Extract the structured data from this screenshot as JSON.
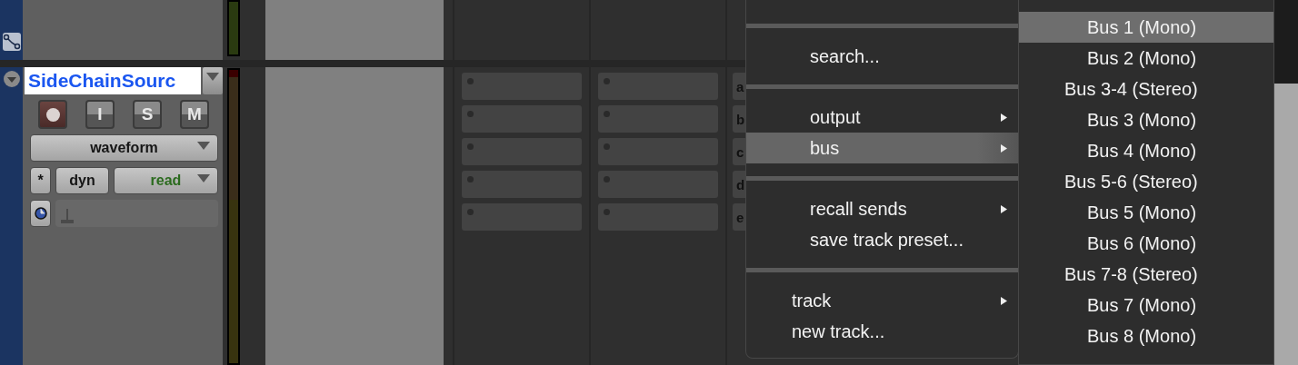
{
  "track": {
    "name": "SideChainSourc",
    "buttons": [
      "I",
      "S",
      "M"
    ],
    "view": "waveform",
    "dyn": "dyn",
    "star": "*",
    "automation_mode": "read",
    "sends": [
      "a",
      "b",
      "c",
      "d",
      "e"
    ]
  },
  "send_menu": {
    "sections": [
      {
        "kind": "send",
        "items": [
          {
            "label": "search...",
            "submenu": false,
            "selected": false
          }
        ]
      },
      {
        "kind": "send",
        "items": [
          {
            "label": "output",
            "submenu": true,
            "selected": false
          },
          {
            "label": "bus",
            "submenu": true,
            "selected": true
          }
        ]
      },
      {
        "kind": "send",
        "items": [
          {
            "label": "recall sends",
            "submenu": true,
            "selected": false
          },
          {
            "label": "save track preset...",
            "submenu": false,
            "selected": false
          }
        ]
      },
      {
        "kind": "track",
        "items": [
          {
            "label": "track",
            "submenu": true,
            "selected": false
          },
          {
            "label": "new track...",
            "submenu": false,
            "selected": false
          }
        ]
      }
    ]
  },
  "bus_menu": {
    "items": [
      {
        "label": "Bus 1 (Mono)",
        "kind": "mono",
        "selected": true
      },
      {
        "label": "Bus 2 (Mono)",
        "kind": "mono",
        "selected": false
      },
      {
        "label": "Bus 3-4 (Stereo)",
        "kind": "stereo",
        "selected": false
      },
      {
        "label": "Bus 3 (Mono)",
        "kind": "mono",
        "selected": false
      },
      {
        "label": "Bus 4 (Mono)",
        "kind": "mono",
        "selected": false
      },
      {
        "label": "Bus 5-6 (Stereo)",
        "kind": "stereo",
        "selected": false
      },
      {
        "label": "Bus 5 (Mono)",
        "kind": "mono",
        "selected": false
      },
      {
        "label": "Bus 6 (Mono)",
        "kind": "mono",
        "selected": false
      },
      {
        "label": "Bus 7-8 (Stereo)",
        "kind": "stereo",
        "selected": false
      },
      {
        "label": "Bus 7 (Mono)",
        "kind": "mono",
        "selected": false
      },
      {
        "label": "Bus 8 (Mono)",
        "kind": "mono",
        "selected": false
      }
    ]
  }
}
